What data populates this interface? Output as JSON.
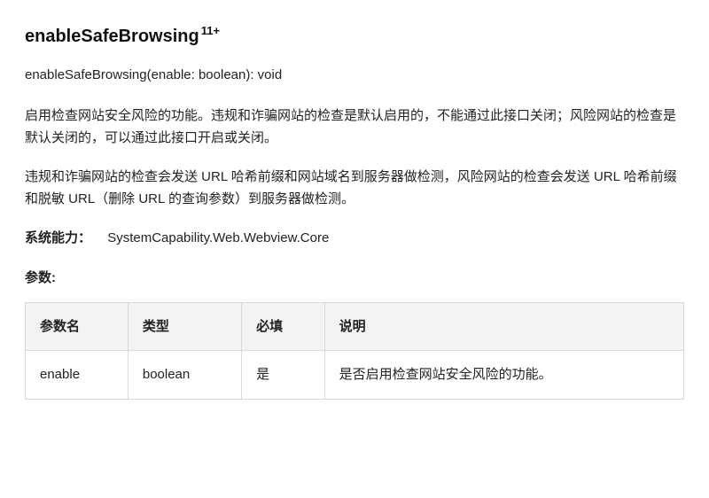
{
  "api": {
    "name": "enableSafeBrowsing",
    "version_badge": "11+",
    "signature": "enableSafeBrowsing(enable: boolean): void",
    "description1": "启用检查网站安全风险的功能。违规和诈骗网站的检查是默认启用的，不能通过此接口关闭；风险网站的检查是默认关闭的，可以通过此接口开启或关闭。",
    "description2": "违规和诈骗网站的检查会发送 URL 哈希前缀和网站域名到服务器做检测，风险网站的检查会发送 URL 哈希前缀和脱敏 URL（删除 URL 的查询参数）到服务器做检测。",
    "capability": {
      "label": "系统能力：",
      "value": "SystemCapability.Web.Webview.Core"
    },
    "params_heading": "参数:",
    "params_table": {
      "headers": {
        "name": "参数名",
        "type": "类型",
        "required": "必填",
        "description": "说明"
      },
      "rows": [
        {
          "name": "enable",
          "type": "boolean",
          "required": "是",
          "description": "是否启用检查网站安全风险的功能。"
        }
      ]
    }
  }
}
